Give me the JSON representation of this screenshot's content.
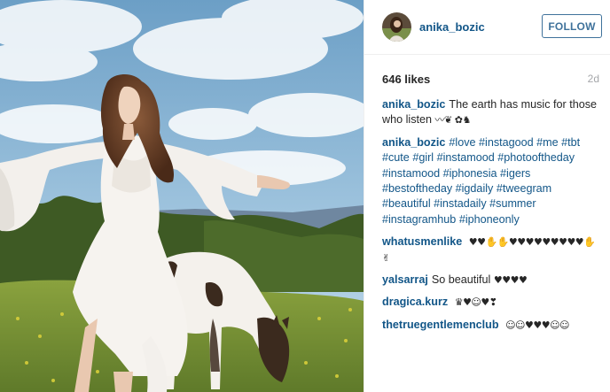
{
  "post": {
    "username": "anika_bozic",
    "follow_label": "FOLLOW",
    "likes": "646 likes",
    "age": "2d",
    "comments": [
      {
        "user": "anika_bozic",
        "text": "The earth has music for those who listen",
        "emoji": "〰❦ ✿♞"
      },
      {
        "user": "anika_bozic",
        "text": "",
        "emoji": "",
        "hashtags": [
          "#love",
          "#instagood",
          "#me",
          "#tbt",
          "#cute",
          "#girl",
          "#instamood",
          "#photooftheday",
          "#instamood",
          "#iphonesia",
          "#igers",
          "#bestoftheday",
          "#igdaily",
          "#tweegram",
          "#beautiful",
          "#instadaily",
          "#summer",
          "#instagramhub",
          "#iphoneonly"
        ]
      },
      {
        "user": "whatusmenlike",
        "text": "",
        "emoji": "♥♥✋✋♥♥♥♥♥♥♥♥♥✋ ✌"
      },
      {
        "user": "yalsarraj",
        "text": "So beautiful",
        "emoji": "♥♥♥♥"
      },
      {
        "user": "dragica.kurz",
        "text": "",
        "emoji": "♛♥☺♥❣"
      },
      {
        "user": "thetruegentlemenclub",
        "text": "",
        "emoji": "☺☺♥♥♥☺☺"
      }
    ]
  },
  "colors": {
    "link": "#125688",
    "follow": "#3f729b",
    "muted": "#a5a7aa"
  },
  "icons": {
    "avatar": "profile-photo"
  }
}
